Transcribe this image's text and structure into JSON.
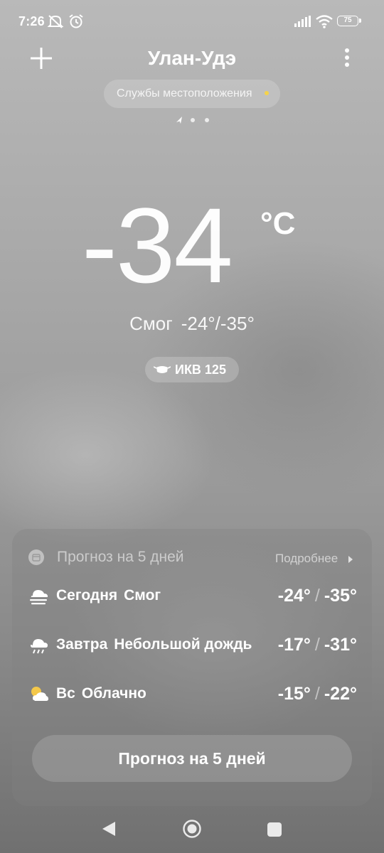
{
  "status_bar": {
    "time": "7:26",
    "battery": "75",
    "icons": [
      "mute-icon",
      "alarm-icon",
      "signal-icon",
      "wifi-icon",
      "battery-icon"
    ]
  },
  "header": {
    "city": "Улан-Удэ",
    "location_services": "Службы местоположения",
    "add_icon": "plus-icon",
    "menu_icon": "more-vertical-icon"
  },
  "current": {
    "temperature": "-34",
    "unit": "°C",
    "condition": "Смог",
    "range": "-24°/-35°",
    "aqi_label": "ИКВ 125"
  },
  "forecast_card": {
    "title": "Прогноз на 5 дней",
    "more_label": "Подробнее",
    "days": [
      {
        "day": "Сегодня",
        "condition": "Смог",
        "high": "-24°",
        "low": "-35°",
        "icon": "smog-icon"
      },
      {
        "day": "Завтра",
        "condition": "Небольшой дождь",
        "high": "-17°",
        "low": "-31°",
        "icon": "rain-icon"
      },
      {
        "day": "Вс",
        "condition": "Облачно",
        "high": "-15°",
        "low": "-22°",
        "icon": "partly-cloudy-icon"
      }
    ],
    "button_label": "Прогноз на 5 дней"
  },
  "colors": {
    "accent_dot": "#f5d34a",
    "sun": "#f4c84a"
  }
}
